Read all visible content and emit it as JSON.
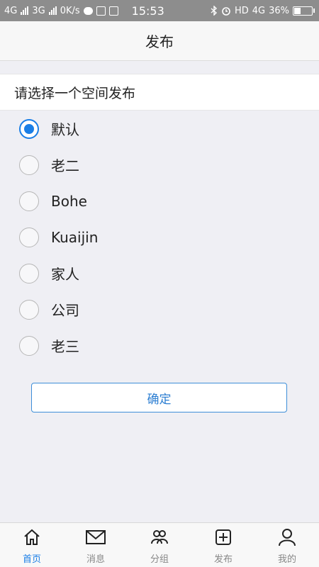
{
  "status_bar": {
    "net1": "4G",
    "net2": "3G",
    "speed": "0K/s",
    "time": "15:53",
    "hd": "HD",
    "net3": "4G",
    "battery": "36%",
    "battery_level": 0.36
  },
  "header": {
    "title": "发布"
  },
  "section": {
    "title": "请选择一个空间发布"
  },
  "options": [
    {
      "label": "默认",
      "selected": true
    },
    {
      "label": "老二",
      "selected": false
    },
    {
      "label": "Bohe",
      "selected": false
    },
    {
      "label": "Kuaijin",
      "selected": false
    },
    {
      "label": "家人",
      "selected": false
    },
    {
      "label": "公司",
      "selected": false
    },
    {
      "label": "老三",
      "selected": false
    }
  ],
  "confirm_label": "确定",
  "tabs": [
    {
      "label": "首页",
      "icon": "home-icon",
      "active": true
    },
    {
      "label": "消息",
      "icon": "mail-icon",
      "active": false
    },
    {
      "label": "分组",
      "icon": "group-icon",
      "active": false
    },
    {
      "label": "发布",
      "icon": "plus-square-icon",
      "active": false
    },
    {
      "label": "我的",
      "icon": "user-icon",
      "active": false
    }
  ],
  "colors": {
    "accent": "#1a7ee6",
    "tab_inactive": "#888888"
  }
}
